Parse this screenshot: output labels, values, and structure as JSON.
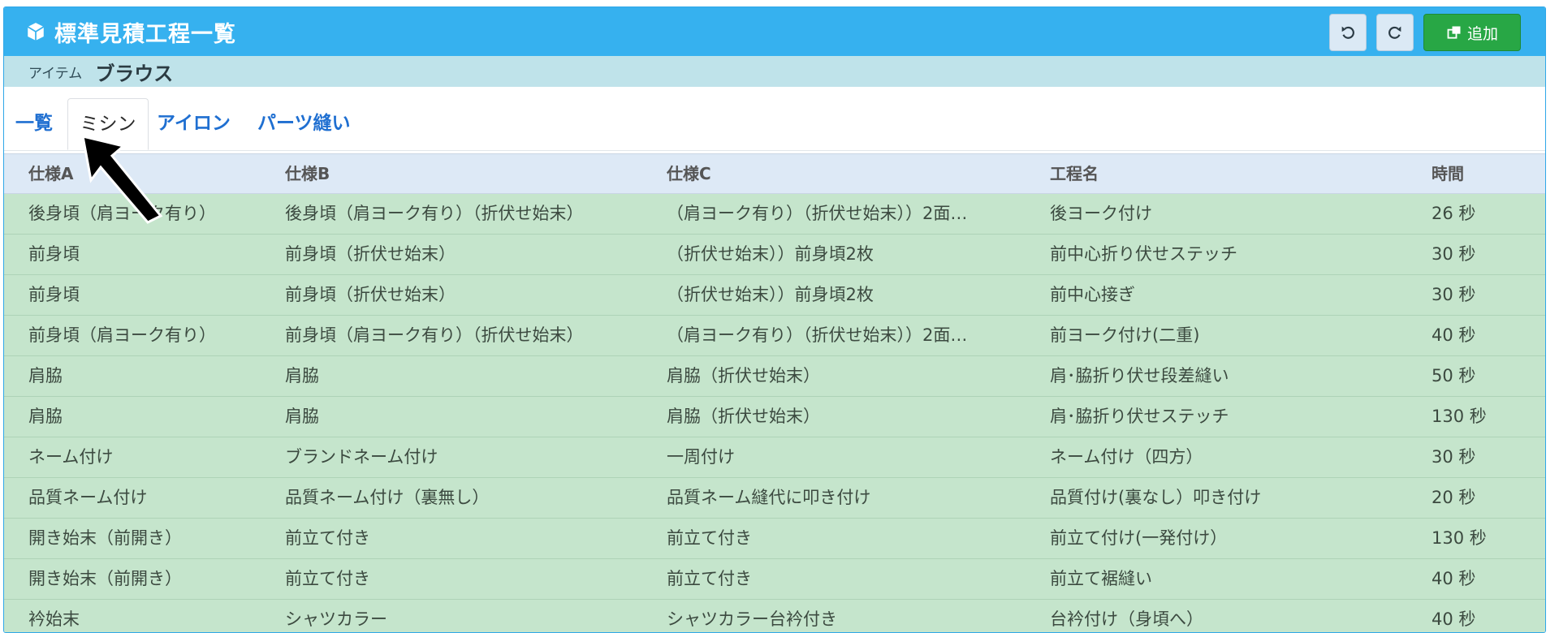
{
  "header": {
    "title": "標準見積工程一覧",
    "title_icon": "cube-icon",
    "undo_icon": "undo-icon",
    "redo_icon": "redo-icon",
    "add_label": "追加",
    "add_icon": "add-window-icon",
    "color": "#36b1ef"
  },
  "item": {
    "label": "アイテム",
    "value": "ブラウス"
  },
  "tabs": [
    {
      "label": "一覧",
      "active": false
    },
    {
      "label": "ミシン",
      "active": true
    },
    {
      "label": "アイロン",
      "active": false
    },
    {
      "label": "パーツ縫い",
      "active": false
    }
  ],
  "table": {
    "columns": [
      "仕様A",
      "仕様B",
      "仕様C",
      "工程名",
      "時間"
    ],
    "rows": [
      [
        "後身頃（肩ヨーク有り）",
        "後身頃（肩ヨーク有り）（折伏せ始末）",
        "（肩ヨーク有り）（折伏せ始末））2面…",
        "後ヨーク付け",
        "26 秒"
      ],
      [
        "前身頃",
        "前身頃（折伏せ始末）",
        "（折伏せ始末））前身頃2枚",
        "前中心折り伏せステッチ",
        "30 秒"
      ],
      [
        "前身頃",
        "前身頃（折伏せ始末）",
        "（折伏せ始末））前身頃2枚",
        "前中心接ぎ",
        "30 秒"
      ],
      [
        "前身頃（肩ヨーク有り）",
        "前身頃（肩ヨーク有り）（折伏せ始末）",
        "（肩ヨーク有り）（折伏せ始末））2面…",
        "前ヨーク付け(二重)",
        "40 秒"
      ],
      [
        "肩脇",
        "肩脇",
        "肩脇（折伏せ始末）",
        "肩･脇折り伏せ段差縫い",
        "50 秒"
      ],
      [
        "肩脇",
        "肩脇",
        "肩脇（折伏せ始末）",
        "肩･脇折り伏せステッチ",
        "130 秒"
      ],
      [
        "ネーム付け",
        "ブランドネーム付け",
        "一周付け",
        "ネーム付け（四方）",
        "30 秒"
      ],
      [
        "品質ネーム付け",
        "品質ネーム付け（裏無し）",
        "品質ネーム縫代に叩き付け",
        "品質付け(裏なし）叩き付け",
        "20 秒"
      ],
      [
        "開き始末（前開き）",
        "前立て付き",
        "前立て付き",
        "前立て付け(一発付け）",
        "130 秒"
      ],
      [
        "開き始末（前開き）",
        "前立て付き",
        "前立て付き",
        "前立て裾縫い",
        "40 秒"
      ],
      [
        "衿始末",
        "シャツカラー",
        "シャツカラー台衿付き",
        "台衿付け（身頃へ）",
        "40 秒"
      ]
    ]
  }
}
